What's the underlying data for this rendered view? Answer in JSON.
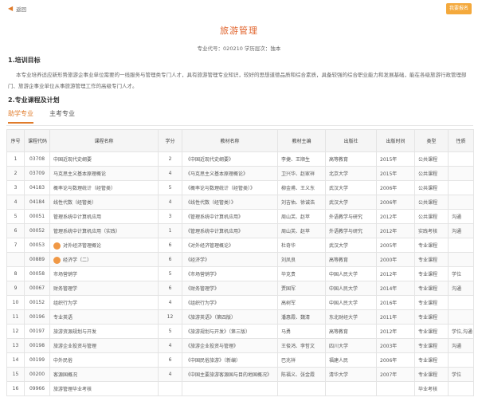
{
  "header": {
    "back_label": "返回",
    "enroll_label": "我要报名"
  },
  "title": "旅游管理",
  "subtitle": "专业代号：020210  学历层次：独本",
  "section1": {
    "heading": "1.培训目标",
    "body": "本专业培养适应新形势旅游企事业单位需要的一线服务与管理类专门人才，具有旅游管理专业知识，较好的思想道德品质和综合素质，具备较强的综合职业能力和发展基础，能在各级旅游行政管理部门、旅游企事业单位从事旅游管理工作的高级专门人才。"
  },
  "section2": {
    "heading": "2.专业课程及计划"
  },
  "tabs": [
    {
      "label": "助学专业",
      "active": true
    },
    {
      "label": "主考专业",
      "active": false
    }
  ],
  "table": {
    "headers": [
      "序号",
      "课程代码",
      "课程名称",
      "学分",
      "教材名称",
      "教材主编",
      "出版社",
      "出版时间",
      "类型",
      "性质"
    ],
    "rows": [
      [
        "1",
        "03708",
        "中国近现代史纲要",
        "2",
        "《中国近现代史纲要》",
        "李捷、王顺生",
        "高等教育",
        "2015年",
        "公共课程",
        ""
      ],
      [
        "2",
        "03709",
        "马克思主义基本原理概论",
        "4",
        "《马克思主义基本原理概论》",
        "卫兴华、赵家祥",
        "北京大学",
        "2015年",
        "公共课程",
        ""
      ],
      [
        "3",
        "04183",
        "概率论与数理统计（经管类）",
        "5",
        "《概率论与数理统计（经管类）》",
        "柳金甫、王义东",
        "武汉大学",
        "2006年",
        "公共课程",
        ""
      ],
      [
        "4",
        "04184",
        "线性代数（经管类）",
        "4",
        "《线性代数（经管类）》",
        "刘吉佑、徐诚浩",
        "武汉大学",
        "2006年",
        "公共课程",
        ""
      ],
      [
        "5",
        "00051",
        "管理系统中计算机应用",
        "3",
        "《管理系统中计算机应用》",
        "周山芙、赵苹",
        "外语教学与研究",
        "2012年",
        "公共课程",
        "沟通"
      ],
      [
        "6",
        "00052",
        "管理系统中计算机应用（实践）",
        "1",
        "《管理系统中计算机应用》",
        "周山芙、赵苹",
        "外语教学与研究",
        "2012年",
        "实践考核",
        "沟通"
      ],
      [
        "7",
        "00053",
        "对外经济管理概论",
        "6",
        "《对外经济管理概论》",
        "杜奇华",
        "武汉大学",
        "2005年",
        "专业课程",
        ""
      ],
      [
        "",
        "00889",
        "经济学（二）",
        "6",
        "《经济学》",
        "刘凤良",
        "高等教育",
        "2000年",
        "专业课程",
        ""
      ],
      [
        "8",
        "00058",
        "市场营销学",
        "5",
        "《市场营销学》",
        "毕克贵",
        "中国人民大学",
        "2012年",
        "专业课程",
        "学位"
      ],
      [
        "9",
        "00067",
        "财务管理学",
        "6",
        "《财务管理学》",
        "贾国军",
        "中国人民大学",
        "2014年",
        "专业课程",
        "沟通"
      ],
      [
        "10",
        "00152",
        "组织行为学",
        "4",
        "《组织行为学》",
        "高树军",
        "中国人民大学",
        "2016年",
        "专业课程",
        ""
      ],
      [
        "11",
        "00196",
        "专业英语",
        "12",
        "《旅游英语》（第四版）",
        "潘惠霞、魏清",
        "东北财经大学",
        "2011年",
        "专业课程",
        ""
      ],
      [
        "12",
        "00197",
        "旅游资源规划与开发",
        "5",
        "《旅游规划与开发》（第三版）",
        "马勇",
        "高等教育",
        "2012年",
        "专业课程",
        "学位,沟通"
      ],
      [
        "13",
        "00198",
        "旅游企业投资与管理",
        "4",
        "《旅游企业投资与管理》",
        "王俊鸿、李哲文",
        "四川大学",
        "2003年",
        "专业课程",
        "沟通"
      ],
      [
        "14",
        "00199",
        "中外民俗",
        "6",
        "《中国民俗旅游》（新编）",
        "巴兆祥",
        "福建人民",
        "2006年",
        "专业课程",
        ""
      ],
      [
        "15",
        "00200",
        "客源国概况",
        "4",
        "《中国主要旅游客源国与目的地国概况》",
        "陈福义、张金霞",
        "清华大学",
        "2007年",
        "专业课程",
        "学位"
      ],
      [
        "16",
        "09966",
        "旅游管理毕业考核",
        "",
        "",
        "",
        "",
        "",
        "毕业考核",
        ""
      ]
    ]
  }
}
